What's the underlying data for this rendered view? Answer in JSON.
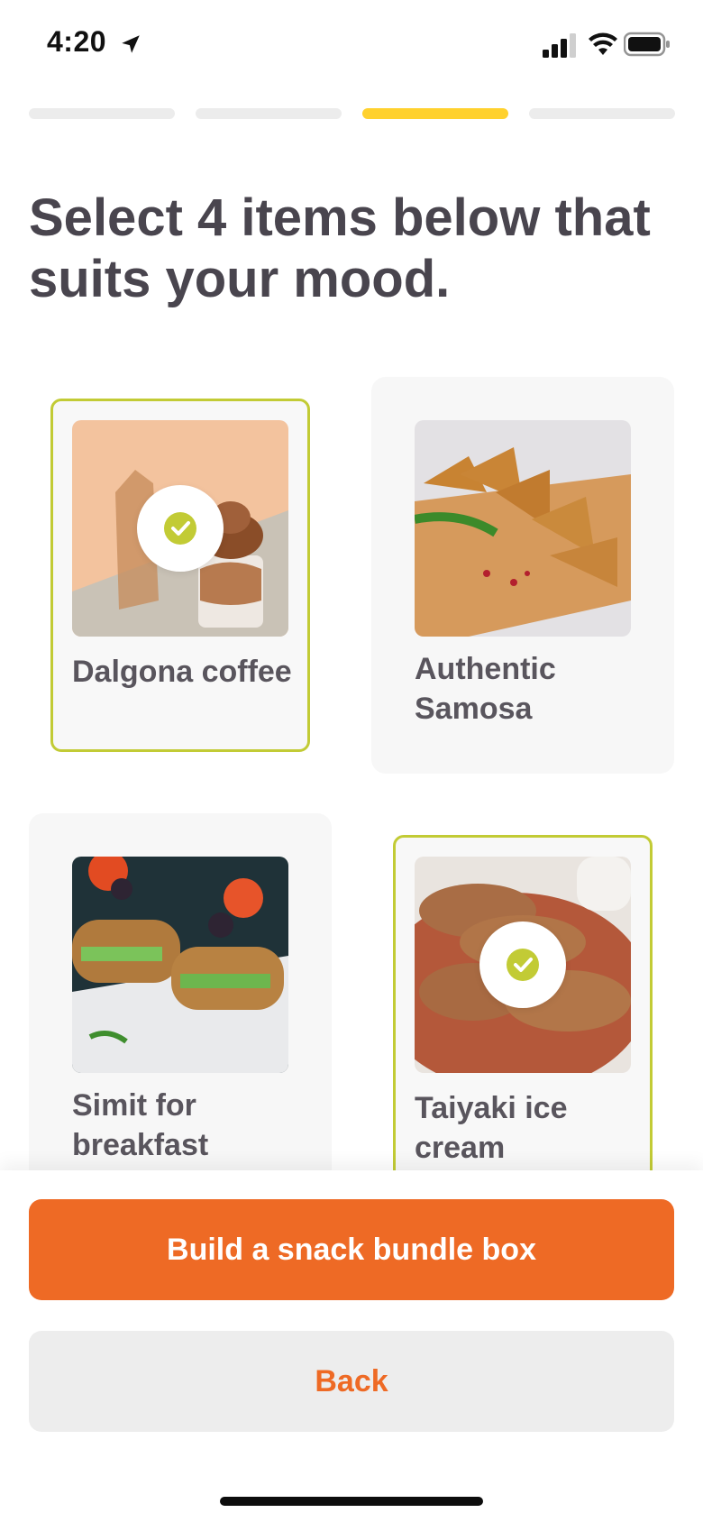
{
  "status_bar": {
    "time": "4:20",
    "icons": [
      "location-arrow-icon",
      "cellular-signal-icon",
      "wifi-icon",
      "battery-icon"
    ]
  },
  "progress": {
    "total_steps": 4,
    "current_step": 3,
    "active_color": "#ffd12e",
    "inactive_color": "#ececec"
  },
  "headline": "Select 4 items below that suits your mood.",
  "items": [
    {
      "label": "Dalgona coffee",
      "selected": true
    },
    {
      "label": "Authentic Samosa",
      "selected": false
    },
    {
      "label": "Simit for breakfast",
      "selected": false
    },
    {
      "label": "Taiyaki ice cream",
      "selected": true
    }
  ],
  "colors": {
    "accent": "#ee6a25",
    "selected_border": "#c2cb35",
    "text_dark": "#49454e"
  },
  "actions": {
    "primary_label": "Build a snack bundle box",
    "secondary_label": "Back"
  }
}
